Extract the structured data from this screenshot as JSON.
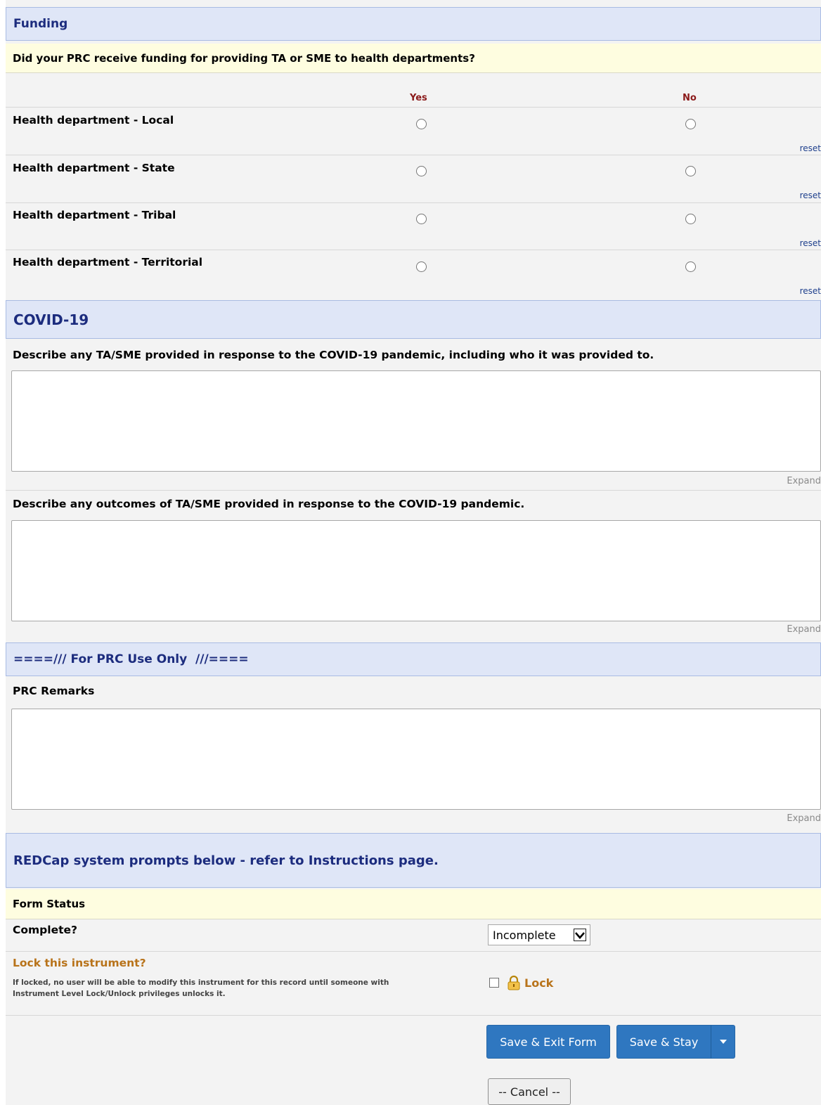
{
  "funding": {
    "header": "Funding",
    "question": "Did your PRC receive funding for providing TA or SME to health departments?",
    "col_yes": "Yes",
    "col_no": "No",
    "rows": [
      {
        "label": "Health department - Local",
        "reset": "reset"
      },
      {
        "label": "Health department - State",
        "reset": "reset"
      },
      {
        "label": "Health department - Tribal",
        "reset": "reset"
      },
      {
        "label": "Health department - Territorial",
        "reset": "reset"
      }
    ]
  },
  "covid": {
    "header": "COVID-19",
    "q1": "Describe any TA/SME provided in response to the COVID-19 pandemic, including who it was provided to.",
    "q2": "Describe any outcomes of TA/SME provided in response to the COVID-19 pandemic.",
    "expand": "Expand"
  },
  "prc": {
    "header": "====/// For PRC Use Only  ///====",
    "remarks_label": "PRC Remarks",
    "expand": "Expand"
  },
  "system": {
    "header": "REDCap system prompts below - refer to Instructions page."
  },
  "form_status": {
    "header": "Form Status",
    "complete_label": "Complete?",
    "complete_value": "Incomplete",
    "lock_label": "Lock this instrument?",
    "lock_desc_1": "If locked, no user will be able to modify this instrument for this record until someone with",
    "lock_desc_2": "Instrument Level Lock/Unlock privileges unlocks it.",
    "lock_checkbox_label": "Lock"
  },
  "buttons": {
    "save_exit": "Save & Exit Form",
    "save_stay": "Save & Stay",
    "cancel": "-- Cancel --"
  },
  "colors": {
    "section_bg": "#dfe6f7",
    "section_text": "#1c2c7e",
    "question_bg": "#fefde0",
    "primary_button": "#2f77c0",
    "lock_label": "#b8731a",
    "yes_no_header": "#8b1a1a"
  }
}
